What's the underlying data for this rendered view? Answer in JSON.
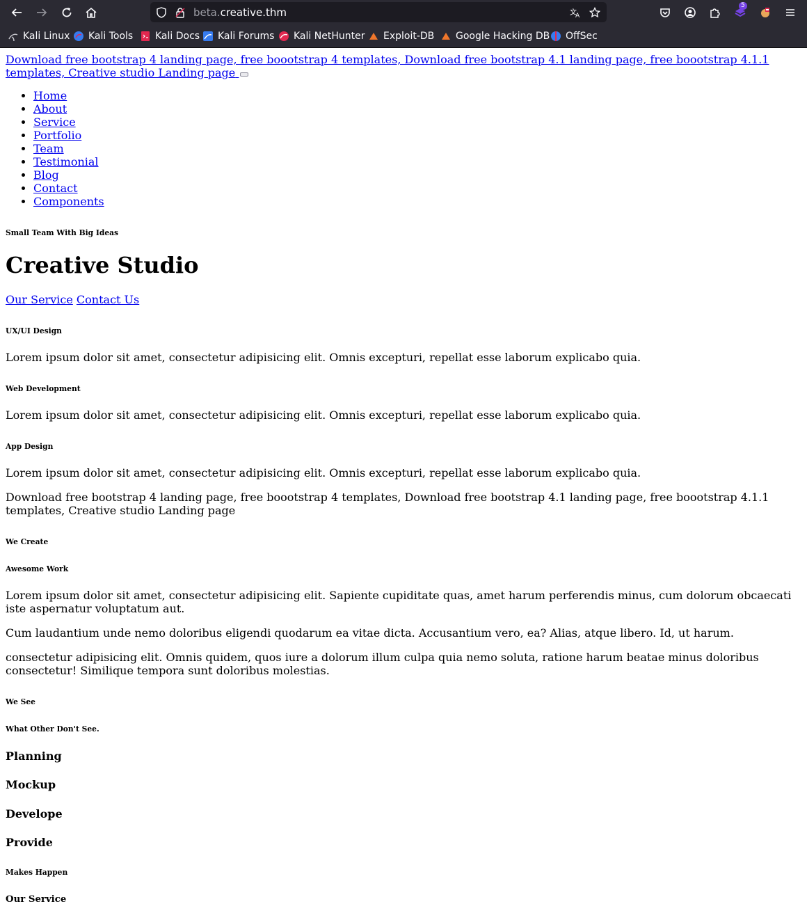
{
  "browser": {
    "url_prefix": "beta.",
    "url_main": "creative.thm",
    "extension_badge": "5",
    "bookmarks": [
      "Kali Linux",
      "Kali Tools",
      "Kali Docs",
      "Kali Forums",
      "Kali NetHunter",
      "Exploit-DB",
      "Google Hacking DB",
      "OffSec"
    ]
  },
  "navbar": {
    "brand": "Download free bootstrap 4 landing page, free boootstrap 4 templates, Download free bootstrap 4.1 landing page, free boootstrap 4.1.1 templates, Creative studio Landing page",
    "menu": [
      "Home",
      "About",
      "Service",
      "Portfolio",
      "Team",
      "Testimonial",
      "Blog",
      "Contact",
      "Components"
    ]
  },
  "hero": {
    "subtitle": "Small Team With Big Ideas",
    "title": "Creative Studio",
    "btn_service": "Our Service",
    "btn_contact": "Contact Us"
  },
  "features": [
    {
      "title": "UX/UI Design",
      "text": "Lorem ipsum dolor sit amet, consectetur adipisicing elit. Omnis excepturi, repellat esse laborum explicabo quia."
    },
    {
      "title": "Web Development",
      "text": "Lorem ipsum dolor sit amet, consectetur adipisicing elit. Omnis excepturi, repellat esse laborum explicabo quia."
    },
    {
      "title": "App Design",
      "text": "Lorem ipsum dolor sit amet, consectetur adipisicing elit. Omnis excepturi, repellat esse laborum explicabo quia."
    }
  ],
  "about": {
    "image_alt": "Download free bootstrap 4 landing page, free boootstrap 4 templates, Download free bootstrap 4.1 landing page, free boootstrap 4.1.1 templates, Creative studio Landing page",
    "subtitle": "We Create",
    "title": "Awesome Work",
    "para1": "Lorem ipsum dolor sit amet, consectetur adipisicing elit. Sapiente cupiditate quas, amet harum perferendis minus, cum dolorum obcaecati iste aspernatur voluptatum aut.",
    "para2": "Cum laudantium unde nemo doloribus eligendi quodarum ea vitae dicta. Accusantium vero, ea? Alias, atque libero. Id, ut harum.",
    "para3": "consectetur adipisicing elit. Omnis quidem, quos iure a dolorum illum culpa quia nemo soluta, ratione harum beatae minus doloribus consectetur! Similique tempora sunt doloribus molestias."
  },
  "process": {
    "subtitle": "We See",
    "title": "What Other Don't See.",
    "steps": [
      "Planning",
      "Mockup",
      "Develope",
      "Provide"
    ]
  },
  "service": {
    "subtitle": "Makes Happen",
    "title": "Our Service"
  }
}
